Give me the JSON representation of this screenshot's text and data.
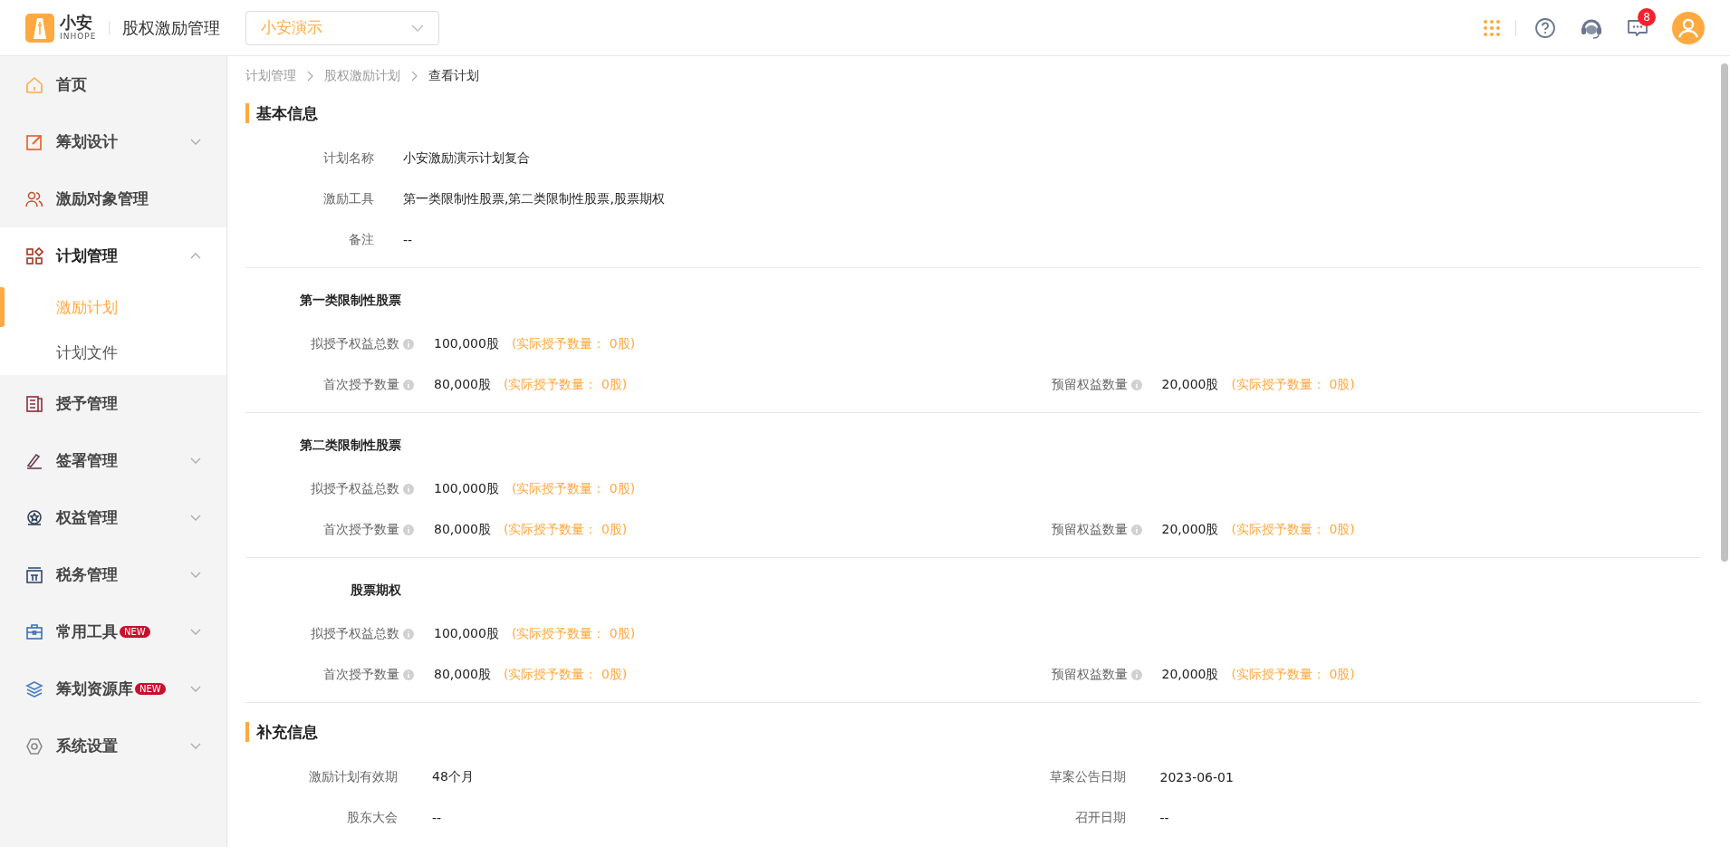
{
  "header": {
    "logo_text": "小安",
    "logo_sub": "INHOPE",
    "app_title": "股权激励管理",
    "company_select": {
      "value": "小安演示"
    },
    "message_badge": "8"
  },
  "sidebar": {
    "items": [
      {
        "label": "首页",
        "kind": "link"
      },
      {
        "label": "筹划设计",
        "kind": "group",
        "expanded": false
      },
      {
        "label": "激励对象管理",
        "kind": "link"
      },
      {
        "label": "计划管理",
        "kind": "group",
        "expanded": true,
        "children": [
          {
            "label": "激励计划",
            "selected": true
          },
          {
            "label": "计划文件",
            "selected": false
          }
        ]
      },
      {
        "label": "授予管理",
        "kind": "link"
      },
      {
        "label": "签署管理",
        "kind": "group",
        "expanded": false
      },
      {
        "label": "权益管理",
        "kind": "group",
        "expanded": false
      },
      {
        "label": "税务管理",
        "kind": "group",
        "expanded": false
      },
      {
        "label": "常用工具",
        "kind": "group",
        "expanded": false,
        "badge": "NEW"
      },
      {
        "label": "筹划资源库",
        "kind": "group",
        "expanded": false,
        "badge": "NEW"
      },
      {
        "label": "系统设置",
        "kind": "group",
        "expanded": false
      }
    ]
  },
  "breadcrumb": [
    {
      "label": "计划管理",
      "current": false
    },
    {
      "label": "股权激励计划",
      "current": false
    },
    {
      "label": "查看计划",
      "current": true
    }
  ],
  "basic_info": {
    "title": "基本信息",
    "fields": [
      {
        "label": "计划名称",
        "value": "小安激励演示计划复合"
      },
      {
        "label": "激励工具",
        "value": "第一类限制性股票,第二类限制性股票,股票期权"
      },
      {
        "label": "备注",
        "value": "--"
      }
    ]
  },
  "instruments": [
    {
      "title": "第一类限制性股票",
      "total": {
        "label": "拟授予权益总数",
        "value": "100,000股",
        "actual": "(实际授予数量： 0股)"
      },
      "first": {
        "label": "首次授予数量",
        "value": "80,000股",
        "actual": "(实际授予数量： 0股)"
      },
      "reserved": {
        "label": "预留权益数量",
        "value": "20,000股",
        "actual": "(实际授予数量： 0股)"
      }
    },
    {
      "title": "第二类限制性股票",
      "total": {
        "label": "拟授予权益总数",
        "value": "100,000股",
        "actual": "(实际授予数量： 0股)"
      },
      "first": {
        "label": "首次授予数量",
        "value": "80,000股",
        "actual": "(实际授予数量： 0股)"
      },
      "reserved": {
        "label": "预留权益数量",
        "value": "20,000股",
        "actual": "(实际授予数量： 0股)"
      }
    },
    {
      "title": "股票期权",
      "total": {
        "label": "拟授予权益总数",
        "value": "100,000股",
        "actual": "(实际授予数量： 0股)"
      },
      "first": {
        "label": "首次授予数量",
        "value": "80,000股",
        "actual": "(实际授予数量： 0股)"
      },
      "reserved": {
        "label": "预留权益数量",
        "value": "20,000股",
        "actual": "(实际授予数量： 0股)"
      }
    }
  ],
  "supplement": {
    "title": "补充信息",
    "fields": [
      {
        "label": "激励计划有效期",
        "value": "48个月"
      },
      {
        "label": "草案公告日期",
        "value": "2023-06-01"
      },
      {
        "label": "股东大会",
        "value": "--"
      },
      {
        "label": "召开日期",
        "value": "--"
      }
    ]
  }
}
